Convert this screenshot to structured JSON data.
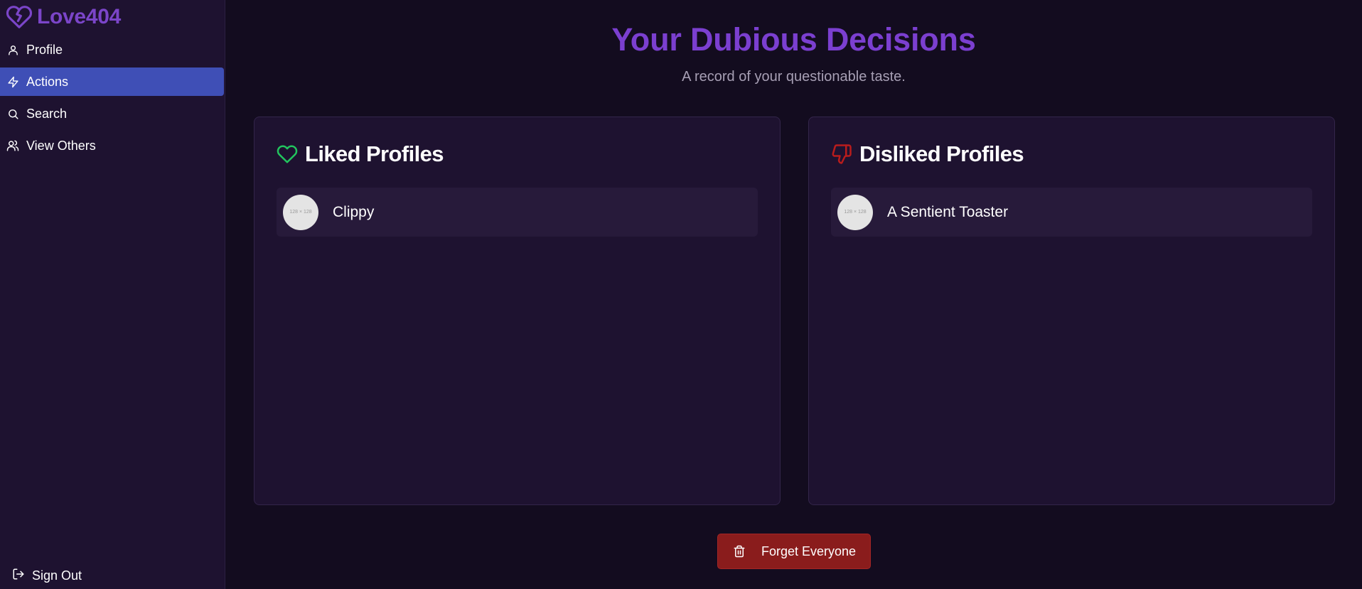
{
  "brand": {
    "name": "Love404",
    "icon": "broken-heart-icon"
  },
  "sidebar": {
    "items": [
      {
        "label": "Profile",
        "icon": "user-icon",
        "active": false
      },
      {
        "label": "Actions",
        "icon": "lightning-icon",
        "active": true
      },
      {
        "label": "Search",
        "icon": "search-icon",
        "active": false
      },
      {
        "label": "View Others",
        "icon": "users-icon",
        "active": false
      }
    ],
    "signout": {
      "label": "Sign Out",
      "icon": "log-out-icon"
    }
  },
  "main": {
    "title": "Your Dubious Decisions",
    "subtitle": "A record of your questionable taste.",
    "liked": {
      "title": "Liked Profiles",
      "icon": "heart-icon",
      "profiles": [
        {
          "name": "Clippy",
          "avatar_text": "128 × 128"
        }
      ]
    },
    "disliked": {
      "title": "Disliked Profiles",
      "icon": "thumbs-down-icon",
      "profiles": [
        {
          "name": "A Sentient Toaster",
          "avatar_text": "128 × 128"
        }
      ]
    },
    "forget_button": {
      "label": "Forget Everyone",
      "icon": "trash-icon"
    }
  },
  "colors": {
    "background": "#130c1f",
    "sidebar": "#1e1230",
    "accent_purple": "#7b3fd0",
    "active_nav": "#3f4fb6",
    "liked_green": "#22c55e",
    "disliked_red": "#b91c1c",
    "danger_button": "#8a1c1c"
  }
}
